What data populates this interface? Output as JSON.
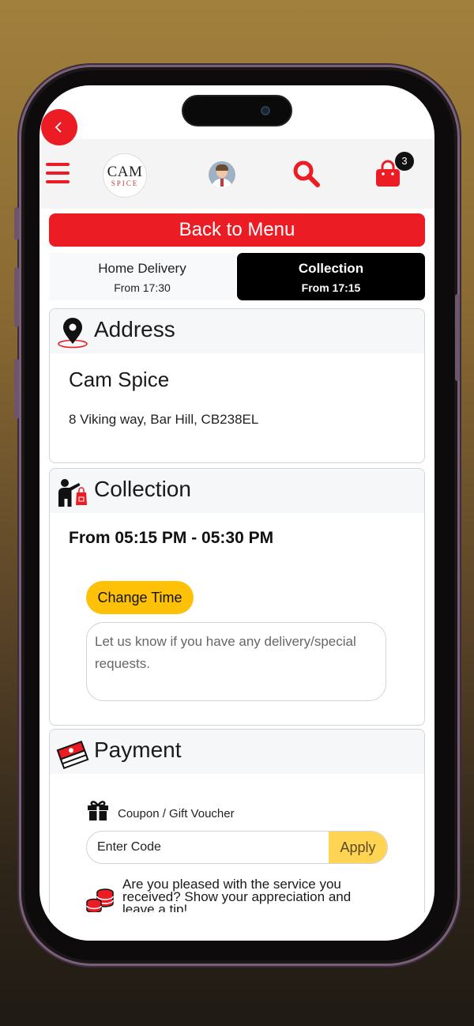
{
  "header": {
    "logo_top": "CAM",
    "logo_bottom": "SPICE",
    "cart_count": "3"
  },
  "back_to_menu": "Back to Menu",
  "tabs": [
    {
      "title": "Home Delivery",
      "sub": "From 17:30",
      "active": false
    },
    {
      "title": "Collection",
      "sub": "From 17:15",
      "active": true
    }
  ],
  "address": {
    "heading": "Address",
    "name": "Cam Spice",
    "line": "8 Viking way, Bar Hill, CB238EL"
  },
  "collection": {
    "heading": "Collection",
    "time": "From 05:15 PM - 05:30 PM",
    "change_time_label": "Change Time",
    "requests_placeholder": "Let us know if you have any delivery/special requests."
  },
  "payment": {
    "heading": "Payment",
    "coupon_label": "Coupon / Gift Voucher",
    "code_placeholder": "Enter Code",
    "apply_label": "Apply",
    "tip_text": "Are you pleased with the service you received? Show your appreciation and leave a tip!"
  },
  "colors": {
    "accent": "#ec1c24",
    "button_yellow": "#ffc107",
    "apply_yellow": "#ffd453"
  },
  "icons": {
    "back": "chevron-left-icon",
    "menu": "hamburger-icon",
    "search": "search-icon",
    "cart": "shopping-bag-icon",
    "address": "location-pin-icon",
    "collection": "person-bag-icon",
    "payment": "money-stack-icon",
    "coupon": "gift-icon",
    "tip": "coins-icon"
  }
}
